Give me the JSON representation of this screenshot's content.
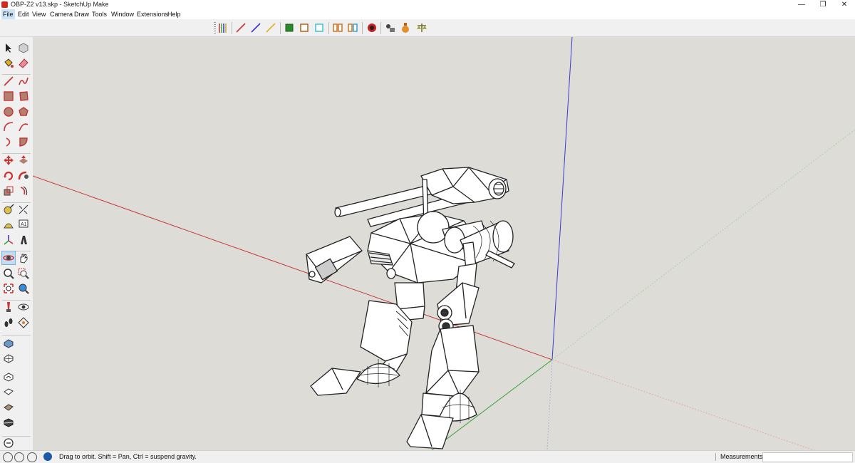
{
  "window": {
    "title": "OBP-Z2 v13.skp - SketchUp Make",
    "minimize": "—",
    "restore": "❐",
    "close": "✕"
  },
  "menu": [
    "File",
    "Edit",
    "View",
    "Camera",
    "Draw",
    "Tools",
    "Window",
    "Extensions",
    "Help"
  ],
  "top_toolbar": [
    "x-ray-lines-icon",
    "red-axis-line-icon",
    "blue-axis-line-icon",
    "yellow-axis-line-icon",
    "green-fill-icon",
    "orange-outline-icon",
    "cyan-outline-icon",
    "orange-double-icon",
    "ruby-icon",
    "paint-drop-icon",
    "bottle-icon",
    "scale-icon"
  ],
  "left_toolbar": [
    "select-icon",
    "make-component-icon",
    "paint-bucket-icon",
    "eraser-icon",
    "line-icon",
    "freehand-icon",
    "rectangle-icon",
    "rotated-rectangle-icon",
    "circle-icon",
    "polygon-icon",
    "arc-icon",
    "two-point-arc-icon",
    "three-point-arc-icon",
    "pie-icon",
    "move-icon",
    "push-pull-icon",
    "rotate-icon",
    "follow-me-icon",
    "scale-icon",
    "offset-icon",
    "tape-measure-icon",
    "dimension-icon",
    "protractor-icon",
    "text-icon",
    "axes-icon",
    "3d-text-icon",
    "orbit-icon",
    "pan-icon",
    "zoom-icon",
    "zoom-window-icon",
    "zoom-extents-icon",
    "previous-view-icon",
    "position-camera-icon",
    "look-around-icon",
    "walk-icon",
    "section-plane-icon",
    "sandbox-from-contours-icon",
    "sandbox-from-scratch-icon",
    "smoove-icon",
    "stamp-icon",
    "drape-icon",
    "add-detail-icon",
    "flip-edge-icon"
  ],
  "status": {
    "text": "Drag to orbit. Shift = Pan, Ctrl = suspend gravity.",
    "measurements_label": "Measurements",
    "measurements_value": ""
  },
  "colors": {
    "viewport": "#dedcd6",
    "axis_red": "#c43c3c",
    "axis_green": "#3aa03a",
    "axis_blue": "#3a3ad0",
    "selection": "#c3dcf2"
  }
}
